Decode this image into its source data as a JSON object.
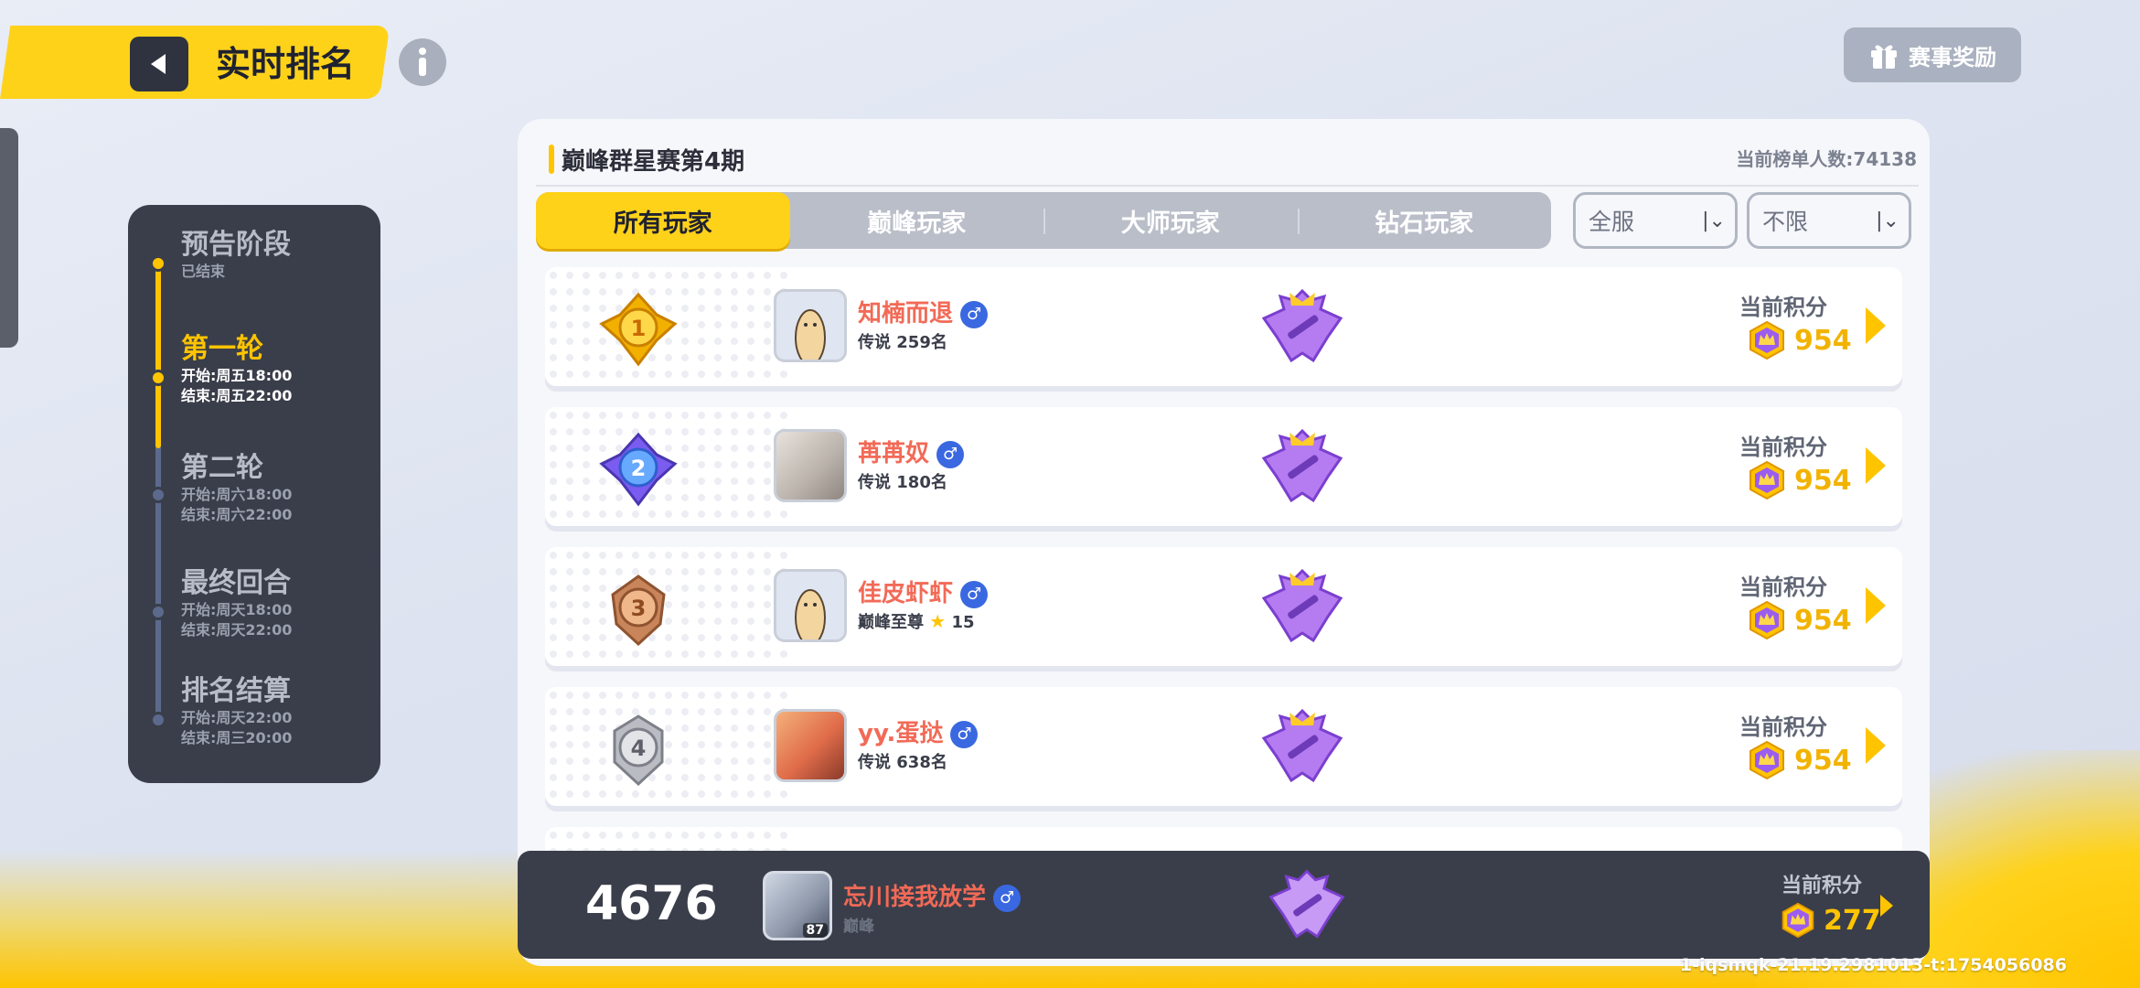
{
  "header": {
    "title": "实时排名",
    "reward_label": "赛事奖励"
  },
  "timeline": {
    "stages": [
      {
        "name": "预告阶段",
        "lines": [
          "已结束"
        ],
        "active": false
      },
      {
        "name": "第一轮",
        "lines": [
          "开始:周五18:00",
          "结束:周五22:00"
        ],
        "active": true
      },
      {
        "name": "第二轮",
        "lines": [
          "开始:周六18:00",
          "结束:周六22:00"
        ],
        "active": false
      },
      {
        "name": "最终回合",
        "lines": [
          "开始:周天18:00",
          "结束:周天22:00"
        ],
        "active": false
      },
      {
        "name": "排名结算",
        "lines": [
          "开始:周天22:00",
          "结束:周三20:00"
        ],
        "active": false
      }
    ]
  },
  "panel": {
    "title": "巅峰群星赛第4期",
    "count_label": "当前榜单人数:74138",
    "tabs": [
      "所有玩家",
      "巅峰玩家",
      "大师玩家",
      "钻石玩家"
    ],
    "filter_server": "全服",
    "filter_limit": "不限"
  },
  "rows": [
    {
      "rank": "1",
      "name": "知楠而退",
      "title": "传说 259名",
      "score_label": "当前积分",
      "score": "954",
      "medal_color": "#f2b000"
    },
    {
      "rank": "2",
      "name": "苒苒奴",
      "title": "传说 180名",
      "score_label": "当前积分",
      "score": "954",
      "medal_color": "#3f7ff0"
    },
    {
      "rank": "3",
      "name": "佳皮虾虾",
      "title": "巅峰至尊",
      "stars": "15",
      "score_label": "当前积分",
      "score": "954",
      "medal_color": "#c9855a"
    },
    {
      "rank": "4",
      "name": "yy.蛋挞",
      "title": "传说 638名",
      "score_label": "当前积分",
      "score": "954",
      "medal_color": "#a6a9b0"
    }
  ],
  "self": {
    "rank": "4676",
    "name": "忘川接我放学",
    "sub": "巅峰",
    "level": "87",
    "score_label": "当前积分",
    "score": "277"
  },
  "version": "1-iqsmqk-21.19.2981013-t:1754056086",
  "colors": {
    "accent": "#ffd21a",
    "name_red": "#f26a57",
    "dark_panel": "#3a3e4a",
    "emblem_purple": "#9b5cf0"
  }
}
